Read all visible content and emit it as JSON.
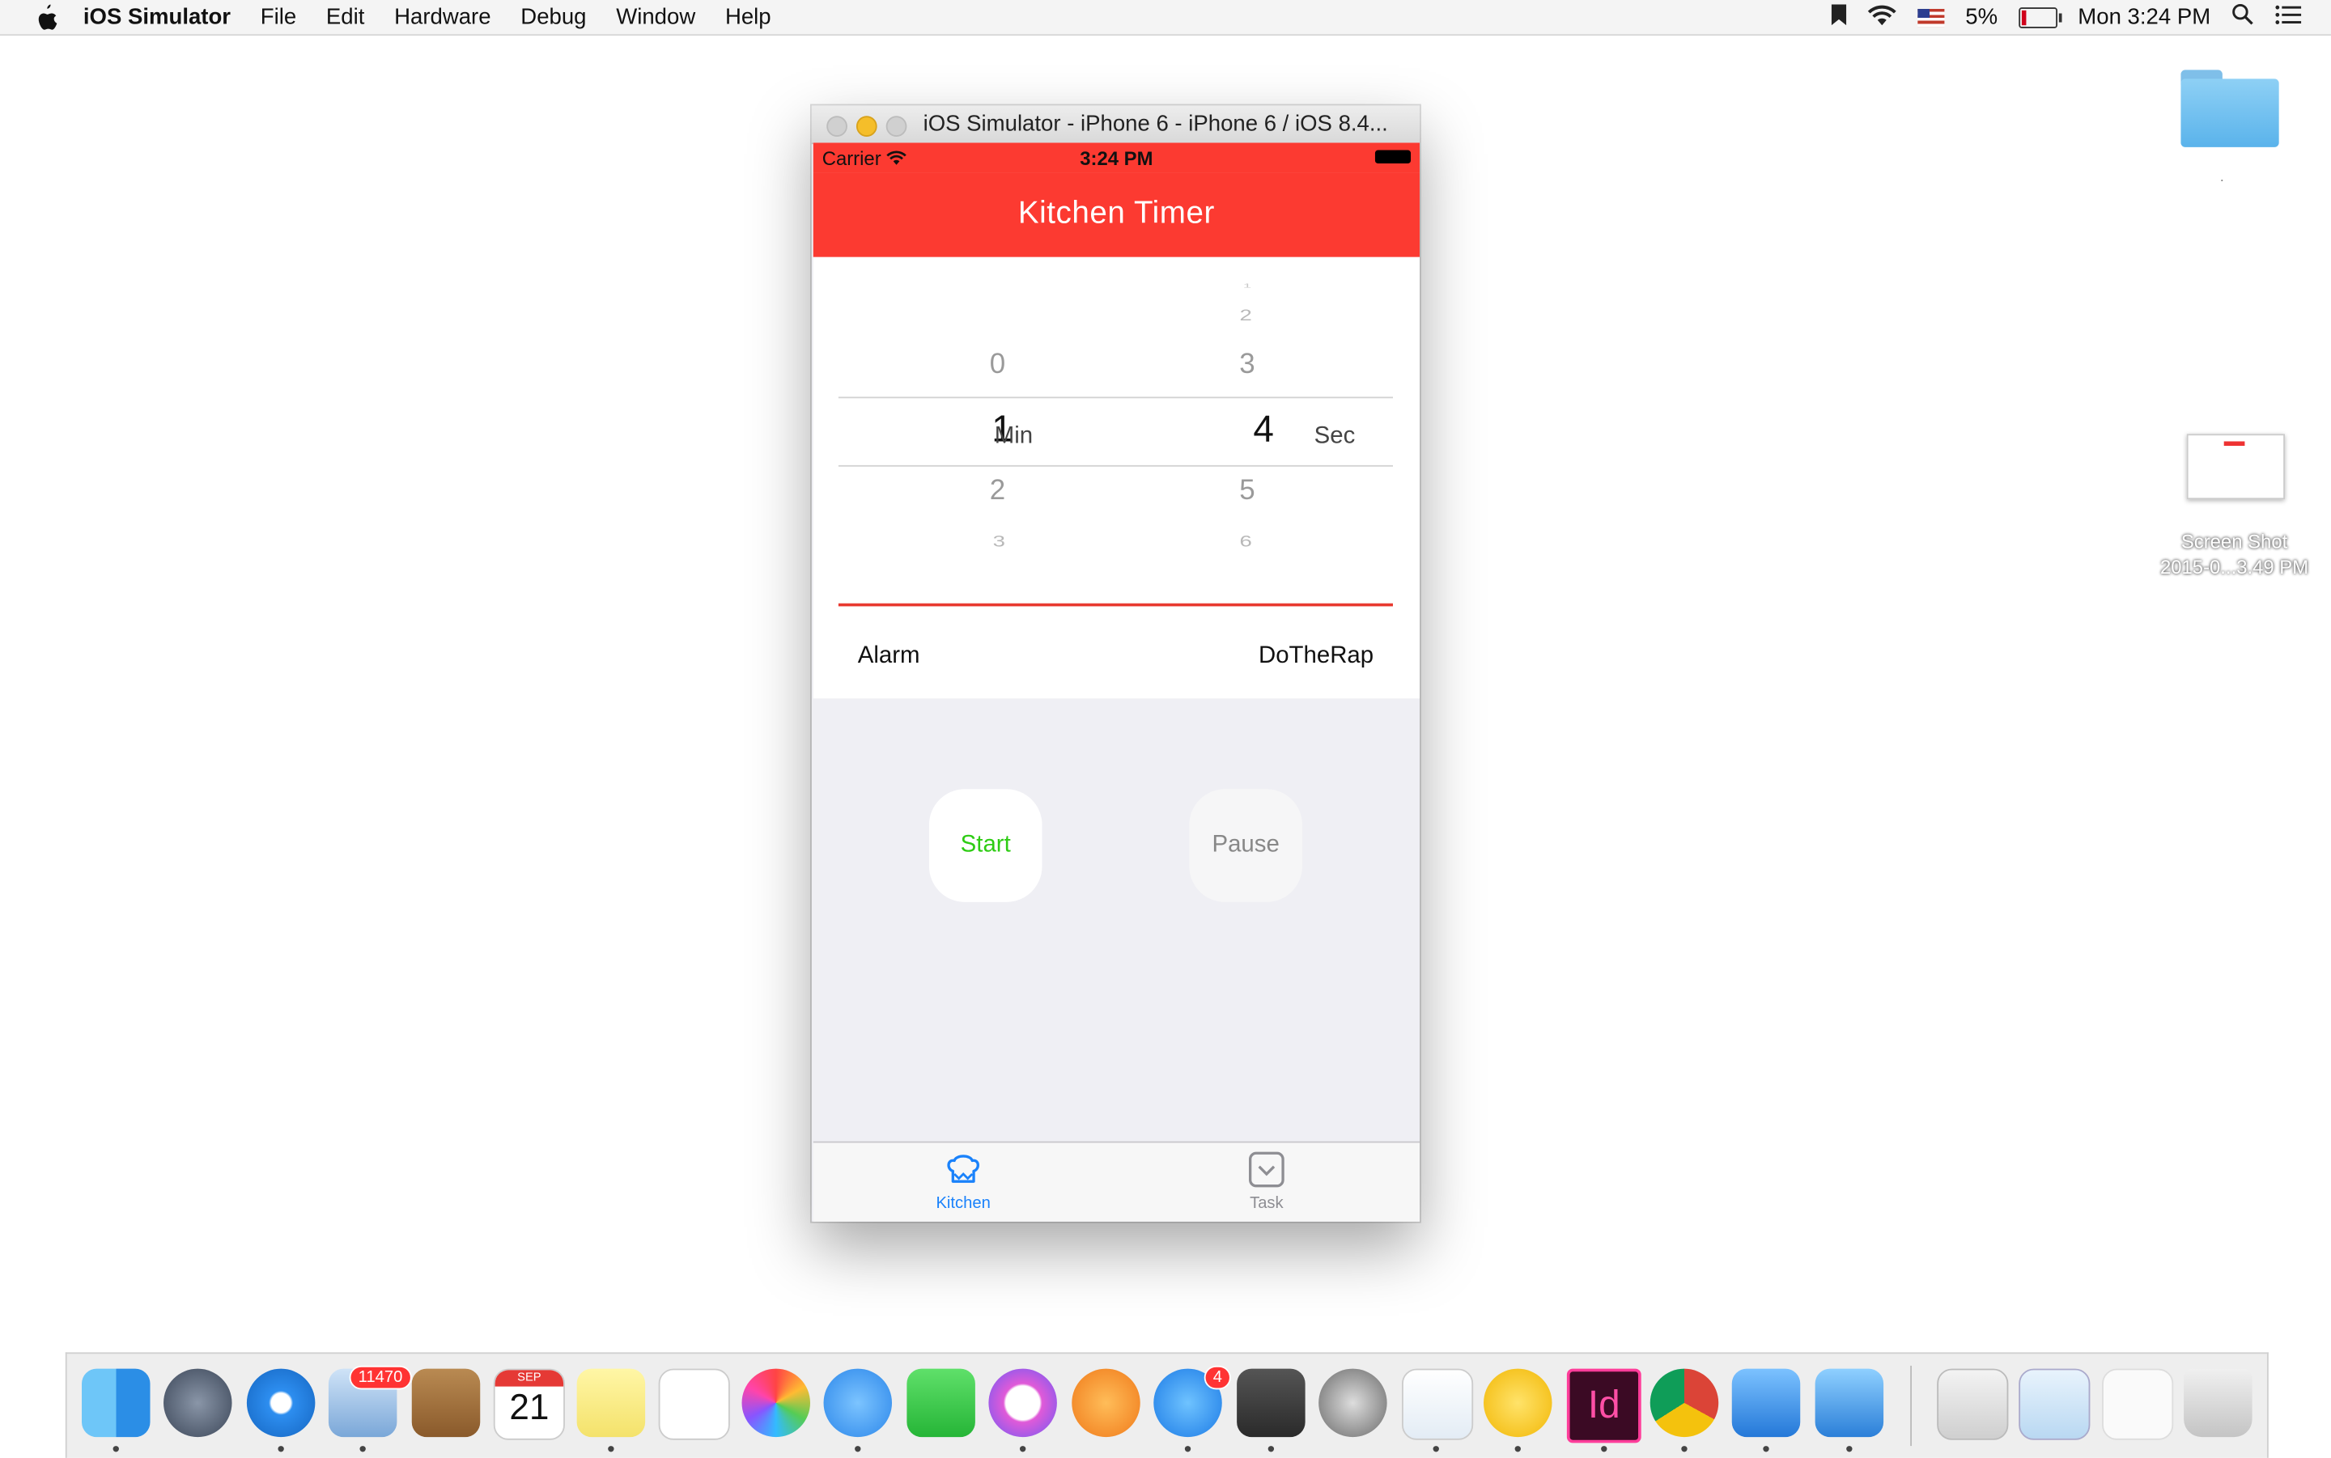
{
  "menubar": {
    "app_name": "iOS Simulator",
    "items": [
      "File",
      "Edit",
      "Hardware",
      "Debug",
      "Window",
      "Help"
    ],
    "battery": "5%",
    "clock": "Mon 3:24 PM"
  },
  "desktop": {
    "screenshot_caption_line1": "Screen Shot",
    "screenshot_caption_line2": "2015-0...3.49 PM"
  },
  "window": {
    "title": "iOS Simulator - iPhone 6 - iPhone 6 / iOS 8.4..."
  },
  "app": {
    "status": {
      "carrier": "Carrier",
      "time": "3:24 PM"
    },
    "nav_title": "Kitchen Timer",
    "picker": {
      "minutes": {
        "above2": "",
        "above1": "0",
        "selected": "1",
        "below1": "2",
        "below2": "3",
        "unit": "Min"
      },
      "seconds": {
        "above3": "1",
        "above2": "2",
        "above1": "3",
        "selected": "4",
        "below1": "5",
        "below2": "6",
        "unit": "Sec"
      }
    },
    "alarm": {
      "label": "Alarm",
      "value": "DoTheRap"
    },
    "buttons": {
      "start": "Start",
      "pause": "Pause"
    },
    "tabs": [
      {
        "label": "Kitchen",
        "active": true
      },
      {
        "label": "Task",
        "active": false
      }
    ],
    "colors": {
      "accent_red": "#fc3a31",
      "start_green": "#2ecc14",
      "tab_active": "#1a82fb"
    }
  },
  "dock": {
    "mail_badge": "11470",
    "calendar_month": "SEP",
    "calendar_day": "21",
    "appstore_badge": "4",
    "indesign_label": "Id"
  }
}
